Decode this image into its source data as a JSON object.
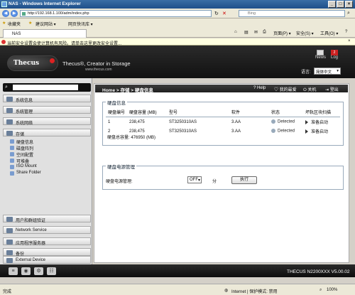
{
  "browser": {
    "title": "NAS - Windows Internet Explorer",
    "url": "http://192.168.1.100/adm/index.php",
    "search_placeholder": "Bing",
    "favorites_label": "收藏夹",
    "fav_items": [
      "建议网站 ▾",
      "网页快讯库 ▾"
    ],
    "tab_label": "NAS",
    "toolbar_items": [
      "页面(P) ▾",
      "安全(S) ▾",
      "工具(O) ▾",
      "?"
    ],
    "infobar_text": "当前安全设置会使计算机有风险。请单击这里更改安全设置..."
  },
  "app": {
    "logo_text": "Thecus",
    "brand": "Thecus®, Creator in Storage",
    "brand_url": "www.thecus.com",
    "news_label": "News",
    "log_label": "Log",
    "log_badge": "2",
    "lang_label": "语言:",
    "lang_value": "简体中文"
  },
  "nav": {
    "categories": [
      {
        "label": "系统信息",
        "icon": "info-icon"
      },
      {
        "label": "系统管理",
        "icon": "tools-icon"
      },
      {
        "label": "系统网络",
        "icon": "network-icon"
      },
      {
        "label": "存储",
        "icon": "storage-icon"
      }
    ],
    "storage_items": [
      "硬盘信息",
      "磁盘阵列",
      "空间配置",
      "可堆叠",
      "ISO Mount",
      "Share Folder"
    ],
    "bottom_categories": [
      "用户和群组验证",
      "Network Service",
      "应用程序服务器",
      "备份",
      "External Device"
    ]
  },
  "main": {
    "breadcrumb_home": "Home",
    "breadcrumb_sep": ">",
    "breadcrumb_section": "存储",
    "breadcrumb_page": "硬盘信息",
    "controls": [
      "Help",
      "我的最爱",
      "关机",
      "登出"
    ],
    "disk_panel_title": "硬盘信息",
    "columns": [
      "硬盘编号",
      "硬盘容量 (MB)",
      "型号",
      "软件",
      "状态",
      "坏轨区块扫描"
    ],
    "rows": [
      {
        "no": "1",
        "capacity": "238,475",
        "model": "ST3250310AS",
        "firmware": "3.AA",
        "status": "Detected",
        "scan": "准备启动"
      },
      {
        "no": "2",
        "capacity": "238,475",
        "model": "ST3250310AS",
        "firmware": "3.AA",
        "status": "Detected",
        "scan": "准备启动"
      }
    ],
    "total_label": "硬盘总容量:",
    "total_value": "476950 (MB)",
    "power_panel_title": "硬盘电源管理",
    "power_label": "硬盘电源管理:",
    "power_value": "OFF",
    "power_unit": "分",
    "apply_label": "执行"
  },
  "footer": {
    "model": "THECUS N2200XXX V5.00.02"
  },
  "statusbar": {
    "left": "完成",
    "zone": "Internet | 保护模式: 禁用",
    "zoom": "100%"
  }
}
